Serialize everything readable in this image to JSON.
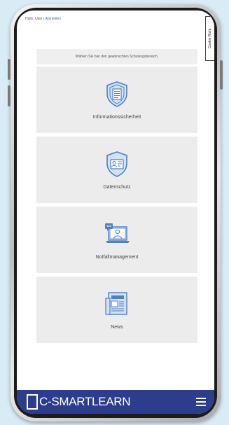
{
  "header": {
    "greeting": "Hallo, User |",
    "logout_link": "Abmelden",
    "cookie_tab": "Cookie Richt"
  },
  "main": {
    "intro": "Wählen Sie hier den gewünschten Schulungsbereich.",
    "tiles": [
      {
        "label": "Informationssicherheit",
        "icon": "shield-document-icon"
      },
      {
        "label": "Datenschutz",
        "icon": "shield-id-card-icon"
      },
      {
        "label": "Notfallmanagement",
        "icon": "laptop-alert-icon"
      },
      {
        "label": "News",
        "icon": "newspaper-icon"
      }
    ]
  },
  "footer": {
    "brand_letter": "C",
    "brand_text": "-SMARTLEARN",
    "menu_icon": "hamburger-menu-icon"
  },
  "colors": {
    "brand": "#2b3d8c",
    "icon_blue": "#4f7fc7",
    "icon_light": "#cfe2f7",
    "tile_bg": "#ececec",
    "page_bg": "#d9ecf6"
  }
}
